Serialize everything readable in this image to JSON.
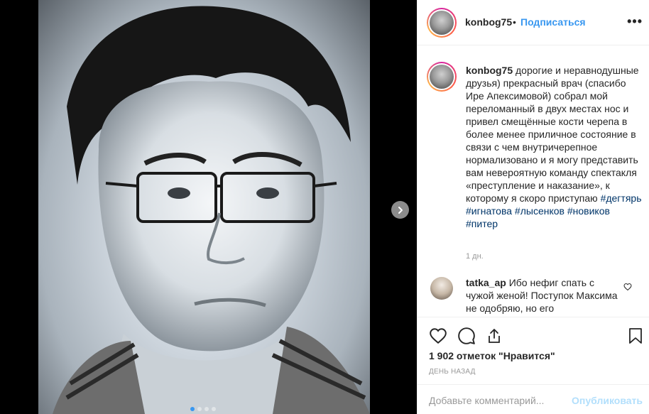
{
  "header": {
    "username": "konbog75",
    "separator": "•",
    "follow_label": "Подписаться",
    "more_label": "•••"
  },
  "media": {
    "slide_count": 4,
    "active_slide": 1
  },
  "caption": {
    "username": "konbog75",
    "text": "дорогие и неравнодушные друзья) прекрасный врач (спасибо Ире Апексимовой) собрал мой переломанный в двух местах нос и привел смещённые кости черепа в более менее приличное состояние в связи с чем внутричерепное нормализовано и я могу представить вам невероятную команду спектакля «преступление и наказание», к которому я скоро приступаю",
    "hashtags": [
      "#дегтярь",
      "#игнатова",
      "#лысенков",
      "#новиков",
      "#питер"
    ],
    "time": "1 дн."
  },
  "comment": {
    "username": "tatka_ap",
    "text": "Ибо нефиг спать с чужой женой! Поступок Максима не одобряю, но его"
  },
  "stats": {
    "likes": "1 902 отметок \"Нравится\"",
    "posted_ago": "ДЕНЬ НАЗАД"
  },
  "add_comment": {
    "placeholder": "Добавьте комментарий...",
    "publish_label": "Опубликовать"
  },
  "colors": {
    "accent": "#3897f0",
    "hashtag": "#003569",
    "publish_disabled": "#b2dffc"
  }
}
